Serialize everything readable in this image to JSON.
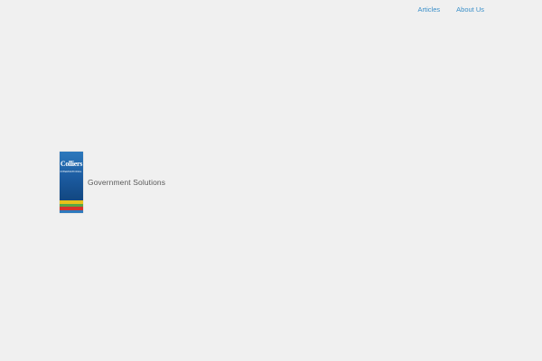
{
  "nav": {
    "items": [
      {
        "label": "Articles"
      },
      {
        "label": "About Us"
      }
    ]
  },
  "brand": {
    "logo_word": "Colliers",
    "logo_sub": "INTERNATIONAL",
    "tagline": "Government Solutions"
  },
  "colors": {
    "background": "#f0f0f0",
    "link": "#3a8fc9",
    "logo_blue": "#1b5a9f",
    "stripe_yellow": "#e8c21a",
    "stripe_green": "#5aa646",
    "stripe_red": "#d8322b"
  }
}
